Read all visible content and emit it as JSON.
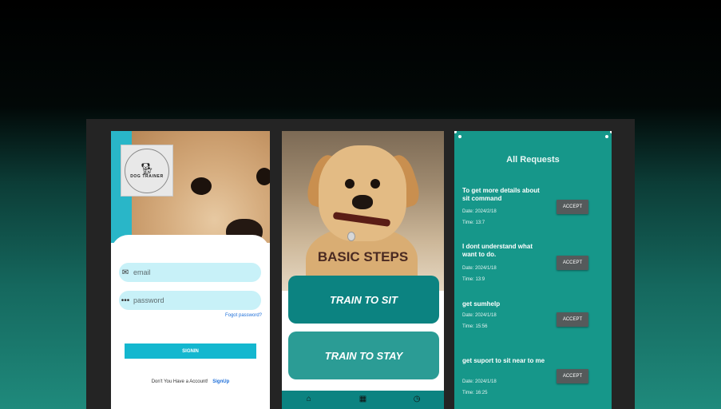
{
  "login_screen": {
    "logo_text": "DOG TRAINER",
    "email_placeholder": "email",
    "password_placeholder": "password",
    "forgot_password": "Fogot password?",
    "signin_label": "SIGNIN",
    "no_account_text": "Don't You Have a Account!",
    "signup_label": "SignUp"
  },
  "steps_screen": {
    "title": "BASIC STEPS",
    "buttons": [
      {
        "label": "TRAIN TO SIT"
      },
      {
        "label": "TRAIN TO STAY"
      }
    ],
    "nav_icons": [
      "home-icon",
      "dashboard-icon",
      "clock-icon"
    ],
    "colors": {
      "primary": "#0c8381",
      "secondary": "#2b9c95"
    }
  },
  "requests_screen": {
    "title": "All Requests",
    "accept_label": "ACCEPT",
    "requests": [
      {
        "message": "To get more details about sit command",
        "date": "Date: 2024/2/18",
        "time": "Time: 13:7"
      },
      {
        "message": "I dont understand what want to do.",
        "date": "Date: 2024/1/18",
        "time": "Time: 13:9"
      },
      {
        "message": "get sumhelp",
        "date": "Date: 2024/1/18",
        "time": "Time: 15:56"
      },
      {
        "message": "get suport to sit near to me",
        "date": "Date: 2024/1/18",
        "time": "Time: 16:25"
      }
    ],
    "colors": {
      "background": "#16978a",
      "button": "#555a5b"
    }
  }
}
